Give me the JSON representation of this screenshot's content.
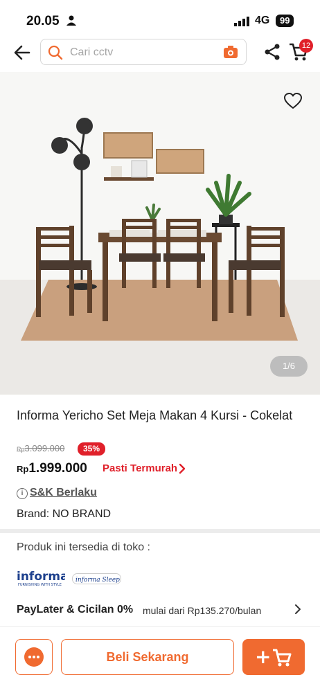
{
  "status": {
    "time": "20.05",
    "network": "4G",
    "battery": "99"
  },
  "search": {
    "placeholder": "Cari cctv"
  },
  "header": {
    "cart_count": "12"
  },
  "gallery": {
    "counter": "1/6"
  },
  "product": {
    "title": "Informa Yericho Set Meja Makan 4 Kursi - Cokelat",
    "old_price_prefix": "Rp",
    "old_price": "3.099.000",
    "discount": "35%",
    "price_prefix": "Rp",
    "price": "1.999.000",
    "cheapest_label": "Pasti Termurah",
    "terms_label": "S&K Berlaku",
    "brand_label": "Brand:",
    "brand_value": "NO BRAND"
  },
  "store": {
    "availability": "Produk ini tersedia di toko :",
    "logos": [
      "informa",
      "informa Sleep"
    ]
  },
  "paylater": {
    "title": "PayLater & Cicilan 0%",
    "subtitle": "mulai dari Rp135.270/bulan"
  },
  "actions": {
    "buy_now": "Beli Sekarang",
    "add_cart_plus": "+"
  },
  "colors": {
    "accent": "#f06a30",
    "discount": "#e0202a",
    "wood": "#6a4a32"
  },
  "icons": [
    "person-icon",
    "signal-icon",
    "back-arrow-icon",
    "search-icon",
    "camera-icon",
    "share-icon",
    "cart-icon",
    "heart-icon",
    "info-icon",
    "chevron-right-icon",
    "chat-icon",
    "add-cart-icon"
  ]
}
